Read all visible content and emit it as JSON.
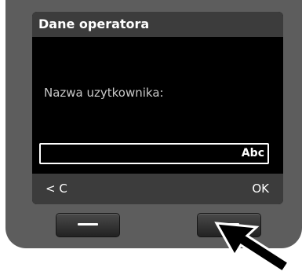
{
  "screen": {
    "title": "Dane operatora",
    "field_label": "Nazwa uzytkownika:",
    "input": {
      "value": "",
      "mode_indicator": "Abc"
    },
    "softkeys": {
      "left_label": "< C",
      "right_label": "OK"
    }
  },
  "hardware_keys": [
    {
      "name": "left-softkey",
      "symbol": "dash"
    },
    {
      "name": "right-softkey",
      "symbol": "dash"
    }
  ],
  "colors": {
    "phone_body": "#5d5d5d",
    "screen_background": "#000000",
    "bar_background": "#3c3c3c",
    "text": "#ffffff",
    "label_text": "#c8c8c8",
    "arrow": "#000000"
  },
  "annotations": {
    "pointer_icon": "arrow-pointing-to-right-softkey"
  }
}
